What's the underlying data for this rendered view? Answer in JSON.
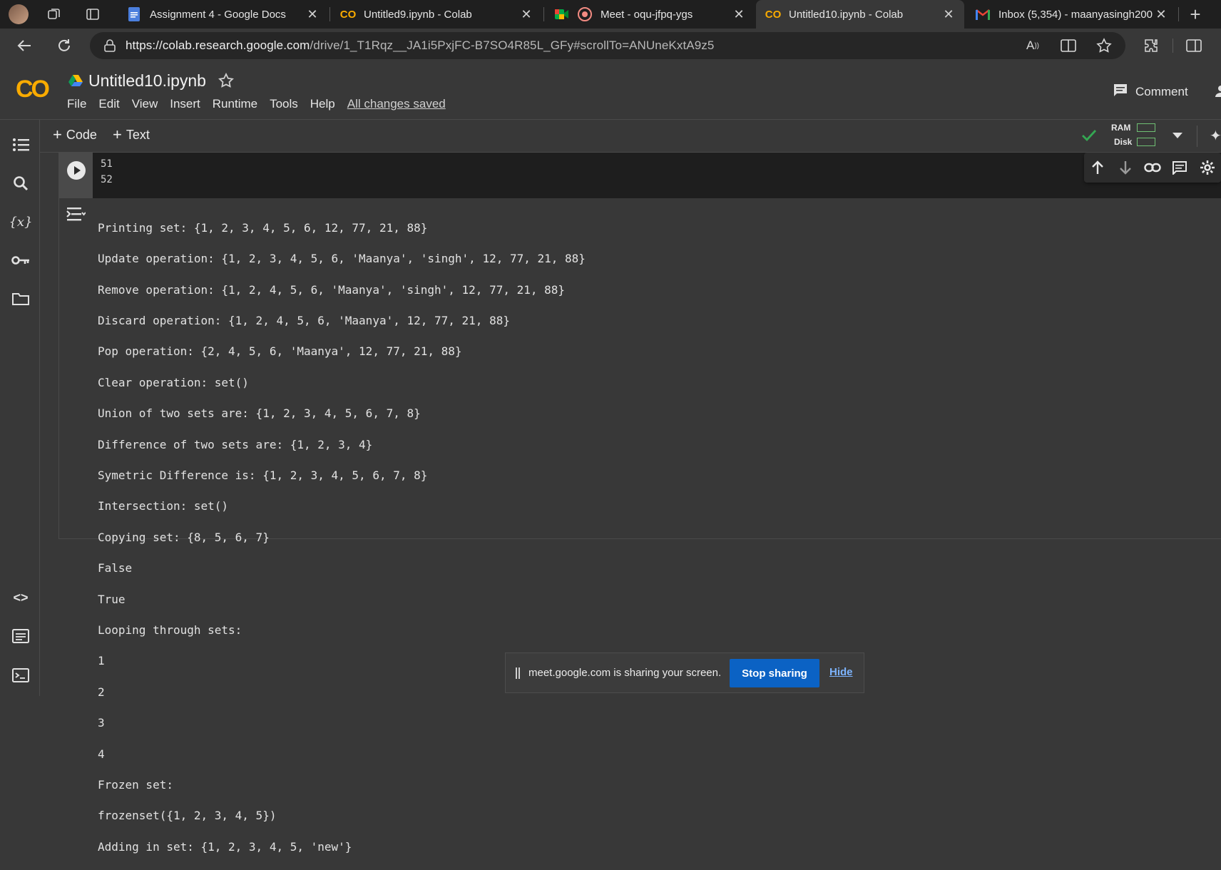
{
  "tabs": [
    {
      "title": "Assignment 4 - Google Docs",
      "icon": "docs-icon"
    },
    {
      "title": "Untitled9.ipynb - Colab",
      "icon": "colab-icon"
    },
    {
      "title": "Meet - oqu-jfpq-ygs",
      "icon": "meet-icon"
    },
    {
      "title": "Untitled10.ipynb - Colab",
      "icon": "colab-icon",
      "active": true
    },
    {
      "title": "Inbox (5,354) - maanyasingh200",
      "icon": "gmail-icon"
    }
  ],
  "address": {
    "domain": "https://colab.research.google.com",
    "path": "/drive/1_T1Rqz__JA1i5PxjFC-B7SO4R85L_GFy#scrollTo=ANUneKxtA9z5"
  },
  "notebook": {
    "title": "Untitled10.ipynb",
    "menu": [
      "File",
      "Edit",
      "View",
      "Insert",
      "Runtime",
      "Tools",
      "Help"
    ],
    "save_status": "All changes saved",
    "comment_label": "Comment"
  },
  "toolbar": {
    "add_code": "Code",
    "add_text": "Text",
    "ram_label": "RAM",
    "disk_label": "Disk"
  },
  "cell": {
    "line_numbers": [
      "51",
      "52"
    ],
    "output_lines": [
      "Printing set: {1, 2, 3, 4, 5, 6, 12, 77, 21, 88}",
      "Update operation: {1, 2, 3, 4, 5, 6, 'Maanya', 'singh', 12, 77, 21, 88}",
      "Remove operation: {1, 2, 4, 5, 6, 'Maanya', 'singh', 12, 77, 21, 88}",
      "Discard operation: {1, 2, 4, 5, 6, 'Maanya', 12, 77, 21, 88}",
      "Pop operation: {2, 4, 5, 6, 'Maanya', 12, 77, 21, 88}",
      "Clear operation: set()",
      "Union of two sets are: {1, 2, 3, 4, 5, 6, 7, 8}",
      "Difference of two sets are: {1, 2, 3, 4}",
      "Symetric Difference is: {1, 2, 3, 4, 5, 6, 7, 8}",
      "Intersection: set()",
      "Copying set: {8, 5, 6, 7}",
      "False",
      "True",
      "Looping through sets:",
      "1",
      "2",
      "3",
      "4",
      "Frozen set:",
      "frozenset({1, 2, 3, 4, 5})",
      "Adding in set: {1, 2, 3, 4, 5, 'new'}"
    ]
  },
  "sharebar": {
    "message": "meet.google.com is sharing your screen.",
    "stop_label": "Stop sharing",
    "hide_label": "Hide"
  },
  "colors": {
    "accent_orange": "#f9ab00",
    "stop_blue": "#0b62c4",
    "check_green": "#34a853"
  }
}
